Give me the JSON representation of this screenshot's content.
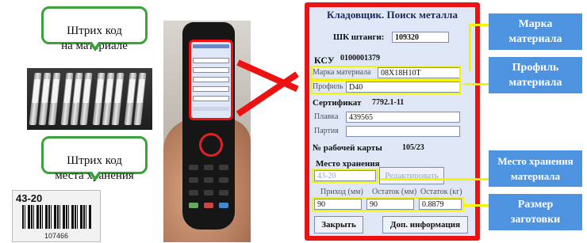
{
  "callouts": {
    "material": "Штрих код\nна материале",
    "storage": "Штрих код\nместа хранения"
  },
  "barcode_card": {
    "code": "43-20",
    "number": "107466"
  },
  "screen": {
    "title": "Кладовщик. Поиск металла",
    "shk_label": "ШК штанги:",
    "shk_value": "109320",
    "ksu_label": "КСУ",
    "ksu_value": "0100001379",
    "grade_label": "Марка материала",
    "grade_value": "08Х18Н10Т",
    "profile_label": "Профиль",
    "profile_value": "D40",
    "cert_label": "Сертификат",
    "cert_value": "7792.1-11",
    "heat_label": "Плавка",
    "heat_value": "439565",
    "batch_label": "Партия",
    "batch_value": "",
    "card_label": "№ рабочей карты",
    "card_value": "105/23",
    "storage_label": "Место хранения",
    "storage_value": "43-20",
    "edit_button": "Редактировать",
    "col_in": "Приход (мм)",
    "col_rest_mm": "Остаток (мм)",
    "col_rest_kg": "Остаток (кг)",
    "in_value": "90",
    "rest_mm_value": "90",
    "rest_kg_value": "0.8879",
    "close_button": "Закрыть",
    "more_button": "Доп. информация"
  },
  "annotations": {
    "grade": "Марка\nматериала",
    "profile": "Профиль\nматериала",
    "storage": "Место хранения\nматериала",
    "blank": "Размер\nзаготовки"
  },
  "colors": {
    "frame": "#ee1111",
    "highlight": "#f4f400",
    "annotation": "#4e93e0",
    "callout_border": "#3aa23a"
  }
}
